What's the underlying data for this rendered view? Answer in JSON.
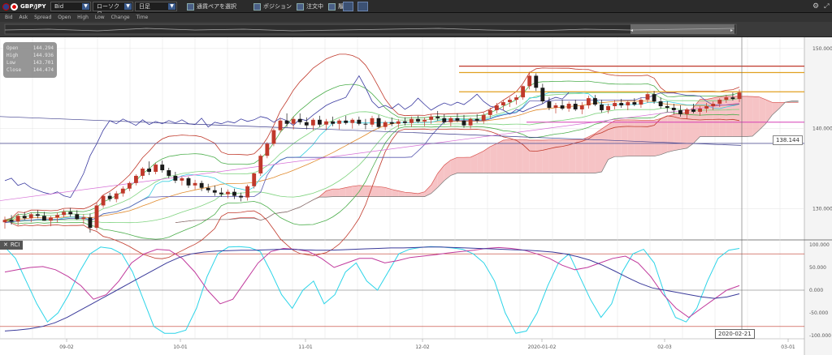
{
  "toolbar": {
    "symbol": "GBP/JPY",
    "price_type": "Bid",
    "chart_type": "ローソク足",
    "period": "日足",
    "multi_pair_label": "通貨ペアを選択",
    "position_label": "ポジション",
    "orders_label": "注文中",
    "history_label": "履歴"
  },
  "legend": {
    "items": [
      "Bid",
      "Ask",
      "Spread",
      "Open",
      "High",
      "Low",
      "Change",
      "Time"
    ]
  },
  "ohlc": {
    "open_label": "Open",
    "open": "144.294",
    "high_label": "High",
    "high": "144.936",
    "low_label": "Low",
    "low": "143.701",
    "close_label": "Close",
    "close": "144.474"
  },
  "indicator": {
    "name": "RCI"
  },
  "current_price": "138.144",
  "cursor_date": "2020-02-21",
  "colors": {
    "background": "#ffffff",
    "cloud_bull": "#f4b8bb",
    "cloud_bear": "#a8a8a8",
    "candle_up": "#c0392b",
    "candle_down": "#1a1a1a",
    "rci_short": "#2bd4e8",
    "rci_mid": "#c0399c",
    "rci_long": "#3a3a9a"
  },
  "chart_data": [
    {
      "type": "candlestick",
      "title": "",
      "y_ticks": [
        "150.000",
        "140.000",
        "130.000"
      ],
      "ylim": [
        126.5,
        151
      ],
      "x_ticks": [
        "09-02",
        "10-01",
        "11-01",
        "12-02",
        "2020-01-02",
        "02-03",
        "03-01"
      ],
      "candles": [
        [
          128.3,
          129.0,
          127.5,
          128.6
        ],
        [
          128.6,
          129.2,
          128.0,
          128.4
        ],
        [
          128.4,
          129.4,
          127.9,
          129.1
        ],
        [
          129.1,
          129.6,
          128.6,
          128.8
        ],
        [
          128.8,
          129.5,
          128.3,
          129.3
        ],
        [
          129.3,
          129.8,
          128.8,
          129.1
        ],
        [
          129.1,
          129.6,
          128.5,
          128.5
        ],
        [
          128.5,
          129.1,
          127.8,
          128.9
        ],
        [
          128.9,
          129.5,
          128.3,
          129.2
        ],
        [
          129.2,
          129.9,
          128.9,
          129.6
        ],
        [
          129.6,
          130.1,
          129.0,
          129.3
        ],
        [
          129.3,
          129.8,
          128.6,
          128.7
        ],
        [
          128.7,
          129.3,
          128.1,
          128.9
        ],
        [
          128.9,
          129.4,
          127.0,
          127.6
        ],
        [
          127.6,
          130.7,
          127.3,
          130.4
        ],
        [
          130.4,
          131.7,
          130.1,
          131.6
        ],
        [
          131.6,
          132.0,
          130.9,
          131.2
        ],
        [
          131.2,
          132.2,
          130.8,
          131.9
        ],
        [
          131.9,
          132.8,
          131.5,
          132.5
        ],
        [
          132.5,
          133.4,
          132.2,
          133.2
        ],
        [
          133.2,
          134.3,
          132.9,
          134.1
        ],
        [
          134.1,
          135.2,
          133.7,
          135.0
        ],
        [
          135.0,
          135.9,
          134.2,
          134.6
        ],
        [
          134.6,
          135.7,
          134.3,
          135.5
        ],
        [
          135.5,
          136.0,
          134.5,
          134.8
        ],
        [
          134.8,
          135.1,
          133.8,
          134.1
        ],
        [
          134.1,
          134.6,
          133.2,
          133.5
        ],
        [
          133.5,
          134.0,
          132.9,
          133.8
        ],
        [
          133.8,
          134.0,
          132.6,
          132.9
        ],
        [
          132.9,
          133.6,
          132.4,
          133.2
        ],
        [
          133.2,
          133.5,
          132.2,
          132.6
        ],
        [
          132.6,
          133.1,
          132.0,
          132.3
        ],
        [
          132.3,
          132.9,
          131.6,
          132.0
        ],
        [
          132.0,
          132.6,
          131.5,
          131.8
        ],
        [
          131.8,
          132.4,
          131.3,
          132.1
        ],
        [
          132.1,
          132.5,
          131.2,
          131.6
        ],
        [
          131.6,
          132.0,
          130.9,
          131.4
        ],
        [
          131.4,
          133.0,
          131.0,
          132.8
        ],
        [
          132.8,
          134.5,
          132.5,
          134.4
        ],
        [
          134.4,
          136.8,
          134.1,
          136.6
        ],
        [
          136.6,
          138.3,
          136.3,
          138.1
        ],
        [
          138.1,
          140.0,
          137.8,
          139.8
        ],
        [
          139.8,
          141.3,
          139.5,
          141.0
        ],
        [
          141.0,
          141.9,
          140.2,
          140.6
        ],
        [
          140.6,
          141.5,
          139.9,
          141.2
        ],
        [
          141.2,
          141.9,
          140.5,
          140.8
        ],
        [
          140.8,
          141.4,
          139.9,
          140.4
        ],
        [
          140.4,
          141.3,
          139.8,
          141.1
        ],
        [
          141.1,
          141.6,
          140.2,
          140.5
        ],
        [
          140.5,
          141.2,
          139.8,
          140.9
        ],
        [
          140.9,
          141.5,
          140.3,
          140.6
        ],
        [
          140.6,
          141.2,
          139.9,
          141.0
        ],
        [
          141.0,
          141.6,
          140.5,
          140.7
        ],
        [
          140.7,
          141.3,
          140.0,
          141.1
        ],
        [
          141.1,
          141.5,
          140.4,
          140.6
        ],
        [
          140.6,
          141.2,
          139.9,
          140.5
        ],
        [
          140.5,
          141.6,
          140.2,
          141.3
        ],
        [
          141.3,
          141.7,
          140.0,
          140.2
        ],
        [
          140.2,
          141.0,
          139.8,
          140.8
        ],
        [
          140.8,
          141.4,
          140.3,
          140.6
        ],
        [
          140.6,
          141.2,
          140.1,
          140.9
        ],
        [
          140.9,
          141.4,
          140.4,
          140.7
        ],
        [
          140.7,
          141.5,
          140.2,
          141.2
        ],
        [
          141.2,
          141.6,
          140.7,
          140.9
        ],
        [
          140.9,
          141.4,
          140.3,
          141.1
        ],
        [
          141.1,
          141.8,
          140.6,
          141.5
        ],
        [
          141.5,
          142.2,
          141.0,
          141.3
        ],
        [
          141.3,
          141.8,
          140.6,
          140.8
        ],
        [
          140.8,
          141.5,
          140.3,
          141.3
        ],
        [
          141.3,
          141.9,
          140.8,
          141.0
        ],
        [
          141.0,
          141.7,
          140.1,
          140.4
        ],
        [
          140.4,
          141.4,
          140.0,
          141.2
        ],
        [
          141.2,
          141.8,
          140.7,
          141.0
        ],
        [
          141.0,
          142.0,
          140.6,
          141.7
        ],
        [
          141.7,
          142.6,
          141.3,
          142.3
        ],
        [
          142.3,
          143.2,
          141.9,
          142.9
        ],
        [
          142.9,
          143.6,
          142.3,
          143.3
        ],
        [
          143.3,
          143.9,
          142.7,
          143.6
        ],
        [
          143.6,
          144.2,
          143.0,
          143.9
        ],
        [
          143.9,
          145.4,
          143.6,
          145.3
        ],
        [
          145.3,
          147.1,
          144.9,
          146.6
        ],
        [
          146.6,
          146.9,
          144.7,
          145.1
        ],
        [
          145.1,
          145.6,
          143.1,
          143.4
        ],
        [
          143.4,
          143.9,
          142.3,
          142.6
        ],
        [
          142.6,
          143.2,
          141.9,
          142.9
        ],
        [
          142.9,
          143.6,
          142.3,
          142.5
        ],
        [
          142.5,
          143.4,
          142.1,
          143.1
        ],
        [
          143.1,
          143.6,
          142.2,
          142.4
        ],
        [
          142.4,
          143.3,
          141.8,
          142.9
        ],
        [
          142.9,
          144.1,
          142.5,
          143.8
        ],
        [
          143.8,
          144.2,
          142.8,
          143.0
        ],
        [
          143.0,
          143.6,
          142.0,
          142.3
        ],
        [
          142.3,
          143.1,
          141.9,
          142.8
        ],
        [
          142.8,
          143.6,
          142.4,
          143.2
        ],
        [
          143.2,
          143.7,
          142.6,
          142.9
        ],
        [
          142.9,
          143.5,
          142.3,
          143.3
        ],
        [
          143.3,
          143.8,
          142.8,
          143.0
        ],
        [
          143.0,
          143.9,
          142.6,
          143.6
        ],
        [
          143.6,
          144.6,
          143.2,
          144.3
        ],
        [
          144.3,
          144.7,
          143.1,
          143.4
        ],
        [
          143.4,
          143.9,
          142.5,
          142.8
        ],
        [
          142.8,
          143.4,
          142.1,
          142.6
        ],
        [
          142.6,
          143.1,
          141.8,
          142.3
        ],
        [
          142.3,
          142.9,
          141.5,
          141.8
        ],
        [
          141.8,
          142.6,
          141.2,
          142.4
        ],
        [
          142.4,
          143.1,
          141.9,
          142.1
        ],
        [
          142.1,
          142.8,
          141.6,
          142.5
        ],
        [
          142.5,
          143.2,
          142.0,
          142.8
        ],
        [
          142.8,
          143.4,
          142.3,
          143.1
        ],
        [
          143.1,
          143.8,
          142.7,
          143.6
        ],
        [
          143.6,
          144.2,
          143.2,
          143.9
        ],
        [
          143.9,
          144.5,
          143.5,
          143.7
        ],
        [
          143.7,
          144.9,
          143.3,
          144.5
        ]
      ],
      "horizontal_lines": [
        147.8,
        147.0,
        144.6,
        140.8,
        138.144
      ]
    },
    {
      "type": "line",
      "title": "",
      "y_ticks": [
        "100.000",
        "50.000",
        "0.000",
        "-50.000",
        "-100.000"
      ],
      "ylim": [
        -100,
        100
      ],
      "series": [
        {
          "values": [
            95,
            70,
            20,
            -30,
            -70,
            -50,
            -10,
            40,
            80,
            95,
            92,
            80,
            40,
            -20,
            -80,
            -95,
            -95,
            -88,
            -40,
            30,
            80,
            95,
            96,
            94,
            85,
            40,
            -10,
            -40,
            0,
            20,
            -30,
            -10,
            40,
            60,
            20,
            0,
            40,
            80,
            90,
            94,
            96,
            95,
            93,
            90,
            80,
            60,
            20,
            -50,
            -95,
            -90,
            -50,
            10,
            60,
            80,
            30,
            -20,
            -60,
            -30,
            40,
            80,
            90,
            60,
            -10,
            -60,
            -70,
            -40,
            20,
            70,
            88,
            92
          ]
        },
        {
          "values": [
            40,
            45,
            50,
            52,
            45,
            30,
            10,
            -20,
            -10,
            20,
            60,
            80,
            90,
            88,
            70,
            40,
            0,
            -30,
            -20,
            20,
            60,
            85,
            92,
            90,
            85,
            70,
            50,
            60,
            70,
            70,
            60,
            65,
            72,
            75,
            78,
            82,
            85,
            88,
            92,
            94,
            92,
            88,
            80,
            70,
            55,
            45,
            50,
            60,
            70,
            75,
            60,
            30,
            -10,
            -40,
            -60,
            -40,
            -20,
            0,
            10
          ]
        },
        {
          "values": [
            -90,
            -88,
            -85,
            -80,
            -72,
            -60,
            -45,
            -30,
            -15,
            0,
            15,
            30,
            45,
            60,
            72,
            80,
            84,
            86,
            87,
            88,
            88,
            89,
            90,
            90,
            89,
            88,
            88,
            89,
            90,
            91,
            92,
            93,
            93,
            94,
            95,
            95,
            94,
            93,
            92,
            91,
            90,
            89,
            88,
            86,
            84,
            80,
            74,
            66,
            55,
            42,
            28,
            15,
            5,
            0,
            -5,
            -10,
            -15,
            -18,
            -15,
            -8
          ]
        }
      ],
      "hlines": [
        80,
        0,
        -80
      ]
    }
  ]
}
